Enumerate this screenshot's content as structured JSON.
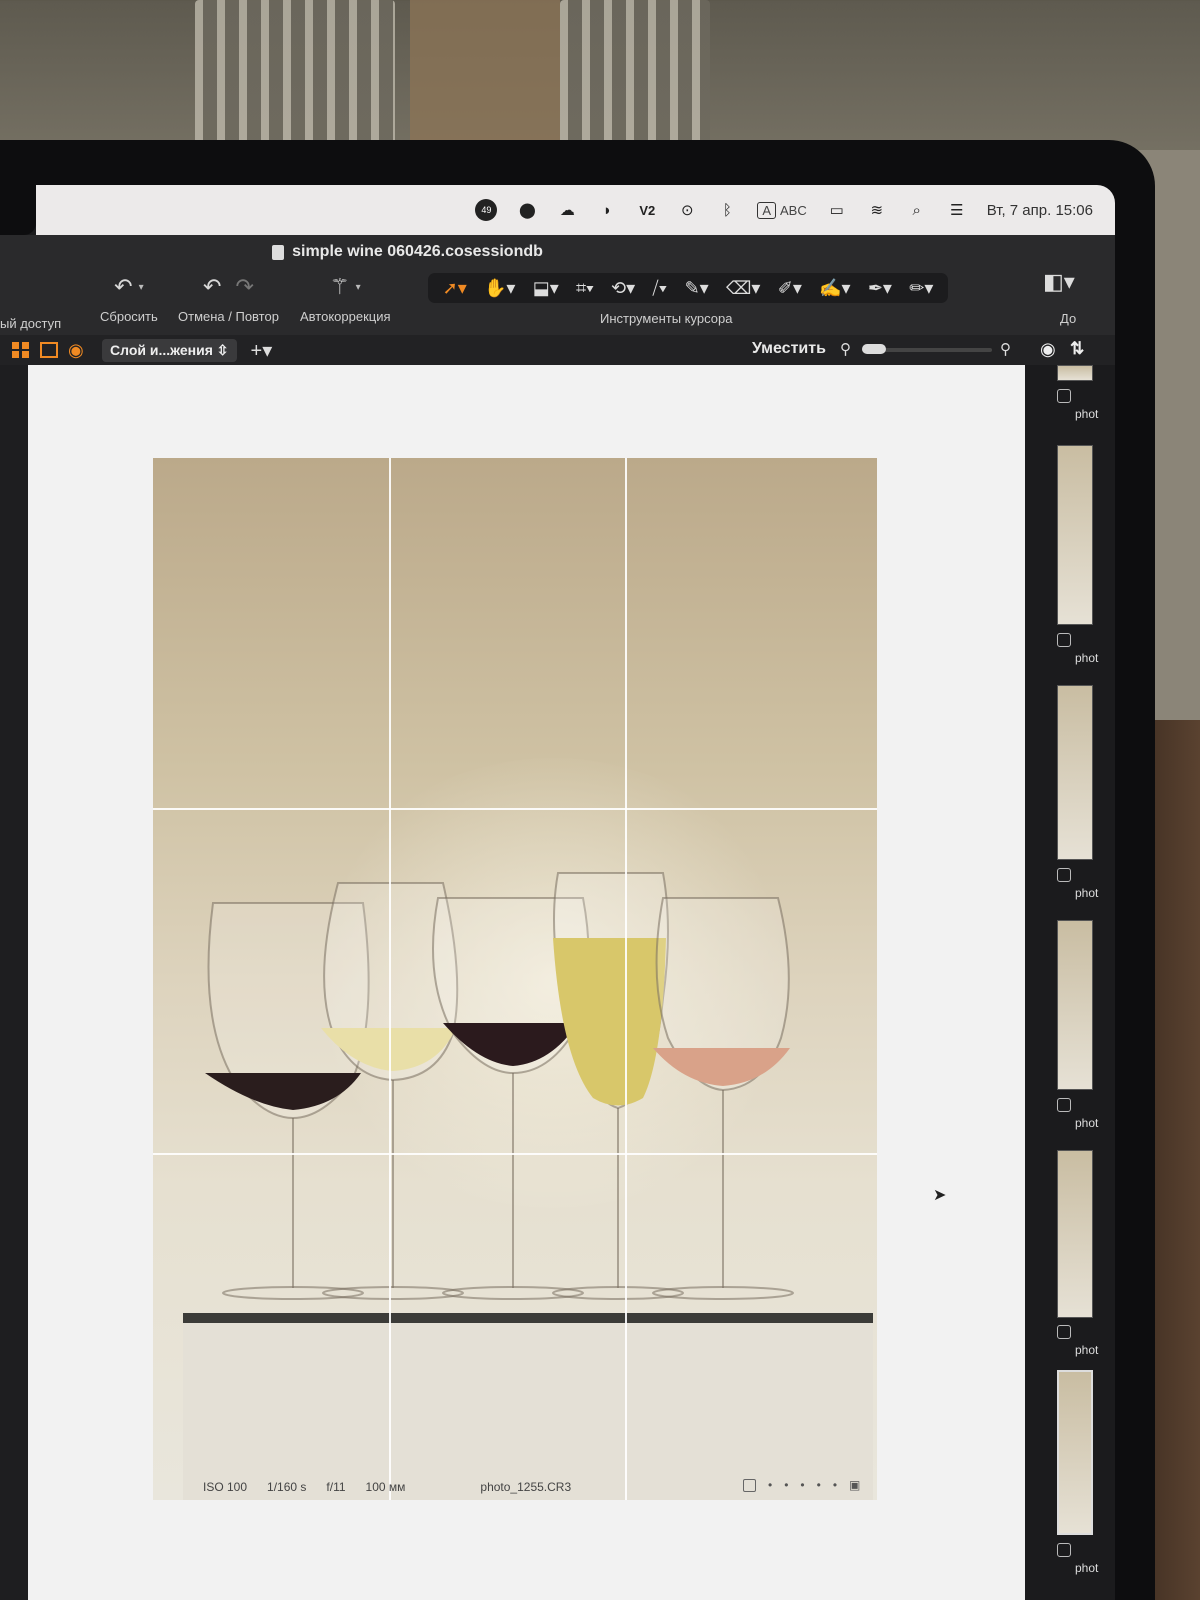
{
  "menubar": {
    "icons": [
      "badge-49-icon",
      "dot-icon",
      "creative-cloud-icon",
      "swift-icon",
      "v2-icon",
      "play-circle-icon",
      "bluetooth-icon",
      "input-source-icon",
      "battery-icon",
      "wifi-icon",
      "search-icon",
      "control-center-icon"
    ],
    "badge_text": "49",
    "v2_text": "V2",
    "input_a": "A",
    "input_abc": "ABC",
    "clock": "Вт, 7 апр. 15:06"
  },
  "window": {
    "title": "simple wine 060426.cosessiondb"
  },
  "toolbar": {
    "access_label": "ый доступ",
    "reset_label": "Сбросить",
    "undo_redo_label": "Отмена / Повтор",
    "autocorrect_label": "Автокоррекция",
    "cursor_tools_label": "Инструменты курсора",
    "before_label": "До"
  },
  "viewbar": {
    "layer_select": "Слой и...жения",
    "fit_label": "Уместить"
  },
  "photo_meta": {
    "iso": "ISO 100",
    "shutter": "1/160 s",
    "aperture": "f/11",
    "focal": "100 мм",
    "filename": "photo_1255.CR3"
  },
  "browser": {
    "thumb_label": "phot"
  },
  "colors": {
    "accent": "#f08a23",
    "toolbar_bg": "#2a2a2c",
    "viewer_bg": "#f2f2f2"
  }
}
